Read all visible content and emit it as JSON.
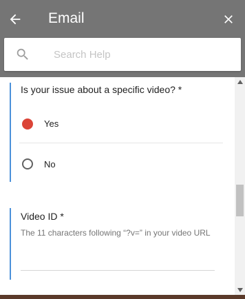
{
  "header": {
    "title": "Email",
    "back_icon": "arrow-left-icon",
    "close_icon": "close-icon",
    "background_color": "#757575"
  },
  "search": {
    "placeholder": "Search Help",
    "value": "",
    "icon": "search-icon"
  },
  "question": {
    "text": "Is your issue about a specific video? *",
    "options": [
      {
        "label": "Yes",
        "selected": true
      },
      {
        "label": "No",
        "selected": false
      }
    ],
    "accent_color": "#db4437"
  },
  "video_id": {
    "label": "Video ID *",
    "help": "The 11 characters following “?v=” in your video URL",
    "value": ""
  },
  "colors": {
    "section_border": "#4a90d9",
    "radio_selected": "#db4437"
  }
}
